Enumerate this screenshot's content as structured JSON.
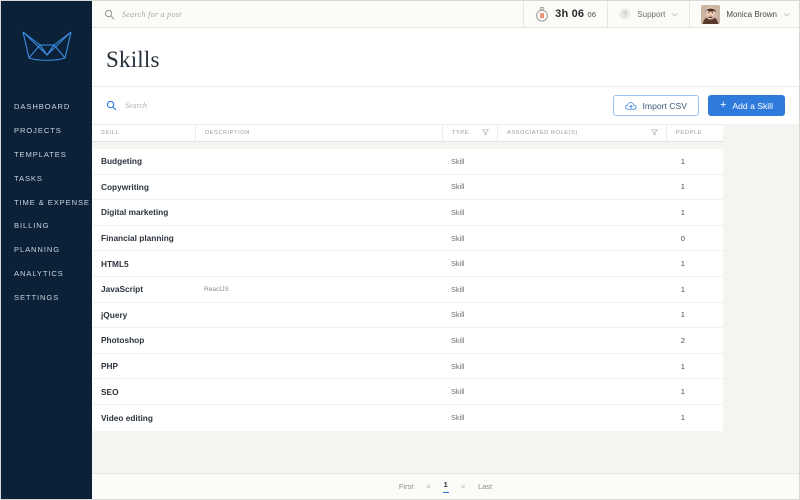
{
  "brand": {
    "logo_icon": "crown-logo-icon",
    "accent": "#2e7bdc",
    "sidebar_bg": "#0a2138"
  },
  "sidebar": {
    "items": [
      {
        "label": "DASHBOARD",
        "name": "dashboard"
      },
      {
        "label": "PROJECTS",
        "name": "projects"
      },
      {
        "label": "TEMPLATES",
        "name": "templates"
      },
      {
        "label": "TASKS",
        "name": "tasks"
      },
      {
        "label": "TIME & EXPENSE",
        "name": "time-expense"
      },
      {
        "label": "BILLING",
        "name": "billing"
      },
      {
        "label": "PLANNING",
        "name": "planning"
      },
      {
        "label": "ANALYTICS",
        "name": "analytics"
      },
      {
        "label": "SETTINGS",
        "name": "settings"
      }
    ]
  },
  "topbar": {
    "search": {
      "placeholder": "Search for a post",
      "value": "",
      "icon": "search-icon"
    },
    "timer": {
      "icon": "stopwatch-pause-icon",
      "hours": "3h 06",
      "seconds": "06",
      "accent": "#e8593c"
    },
    "support": {
      "label": "Support",
      "icon": "help-circle-icon",
      "chevron": "chevron-down-icon"
    },
    "user": {
      "name": "Monica Brown",
      "avatar": "user-avatar",
      "chevron": "chevron-down-icon"
    }
  },
  "page": {
    "title": "Skills"
  },
  "toolbar": {
    "search": {
      "placeholder": "Search",
      "value": "",
      "icon": "search-icon"
    },
    "import_label": "Import CSV",
    "import_icon": "cloud-upload-icon",
    "add_label": "Add a Skill",
    "add_icon": "plus-icon"
  },
  "table": {
    "columns": [
      {
        "label": "SKILL",
        "key": "skill",
        "filter": false
      },
      {
        "label": "DESCRIPTION",
        "key": "description",
        "filter": false
      },
      {
        "label": "TYPE",
        "key": "type",
        "filter": true
      },
      {
        "label": "ASSOCIATED ROLE(S)",
        "key": "roles",
        "filter": true
      },
      {
        "label": "PEOPLE",
        "key": "people",
        "filter": false
      }
    ],
    "rows": [
      {
        "skill": "Budgeting",
        "description": "",
        "type": "Skill",
        "roles": "",
        "people": "1"
      },
      {
        "skill": "Copywriting",
        "description": "",
        "type": "Skill",
        "roles": "",
        "people": "1"
      },
      {
        "skill": "Digital marketing",
        "description": "",
        "type": "Skill",
        "roles": "",
        "people": "1"
      },
      {
        "skill": "Financial planning",
        "description": "",
        "type": "Skill",
        "roles": "",
        "people": "0"
      },
      {
        "skill": "HTML5",
        "description": "",
        "type": "Skill",
        "roles": "",
        "people": "1"
      },
      {
        "skill": "JavaScript",
        "description": "ReactJS",
        "type": "Skill",
        "roles": "",
        "people": "1"
      },
      {
        "skill": "jQuery",
        "description": "",
        "type": "Skill",
        "roles": "",
        "people": "1"
      },
      {
        "skill": "Photoshop",
        "description": "",
        "type": "Skill",
        "roles": "",
        "people": "2"
      },
      {
        "skill": "PHP",
        "description": "",
        "type": "Skill",
        "roles": "",
        "people": "1"
      },
      {
        "skill": "SEO",
        "description": "",
        "type": "Skill",
        "roles": "",
        "people": "1"
      },
      {
        "skill": "Video editing",
        "description": "",
        "type": "Skill",
        "roles": "",
        "people": "1"
      }
    ]
  },
  "pagination": {
    "first": "First",
    "prev": "<",
    "current": "1",
    "next": ">",
    "last": "Last"
  }
}
